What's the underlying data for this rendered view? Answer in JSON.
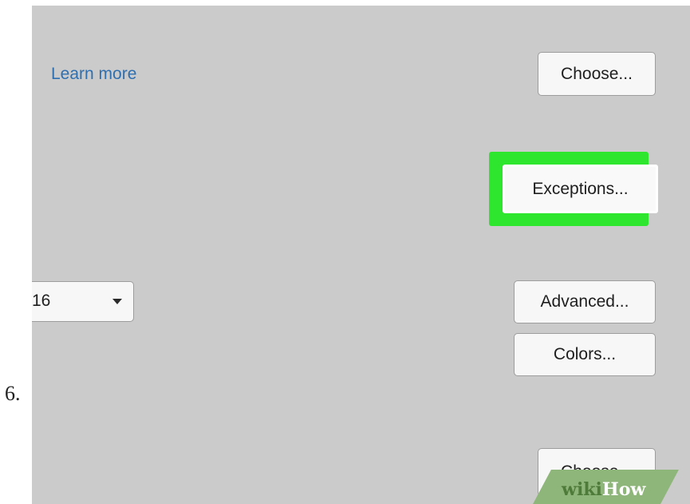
{
  "step": {
    "number": "6."
  },
  "settings": {
    "learn_more_link": "Learn more",
    "choose_button_top": "Choose...",
    "exceptions_button": "Exceptions...",
    "font_size_select_value": "16",
    "advanced_button": "Advanced...",
    "colors_button": "Colors...",
    "choose_button_bottom": "Choose..."
  },
  "highlight": {
    "color": "#2ee62e",
    "target": "exceptions-button"
  },
  "watermark": {
    "part1": "wiki",
    "part2": "How"
  },
  "icons": {
    "select_caret": "caret-down-icon"
  },
  "colors": {
    "panel_background": "#cbcbcb",
    "link": "#2f6fb0",
    "button_background": "#f7f7f7"
  }
}
